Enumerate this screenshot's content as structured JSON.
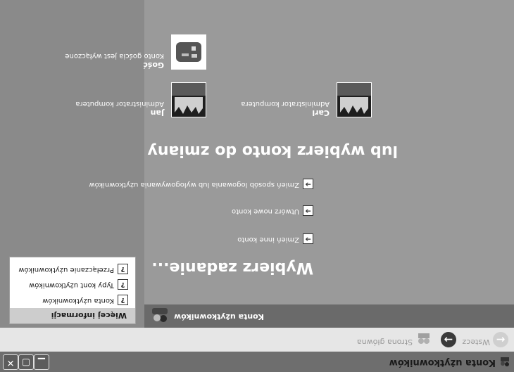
{
  "window": {
    "title": "Konta użytkowników"
  },
  "toolbar": {
    "back_label": "Wstecz",
    "home_label": "Strona główna"
  },
  "header": {
    "section_label": "Konta użytkowników"
  },
  "info": {
    "title": "Więcej informacji",
    "items": [
      "Konta użytkowników",
      "Typy kont użytkowników",
      "Przełączanie użytkowników"
    ]
  },
  "tasks": {
    "heading": "Wybierz zadanie...",
    "items": [
      "Zmień inne konto",
      "Utwórz nowe konto",
      "Zmień sposób logowania lub wylogowywania użytkowników"
    ]
  },
  "accounts": {
    "heading": "lub wybierz konto do zmiany",
    "items": [
      {
        "name": "Carl",
        "desc": "Administrator komputera"
      },
      {
        "name": "Jan",
        "desc": "Administrator komputera"
      },
      {
        "name": "Gość",
        "desc": "Konto gościa jest wyłączone"
      }
    ]
  },
  "icons": {
    "task_arrow": "arrow-right-icon",
    "info_item": "help-icon",
    "accent": "#6a6a6a"
  }
}
